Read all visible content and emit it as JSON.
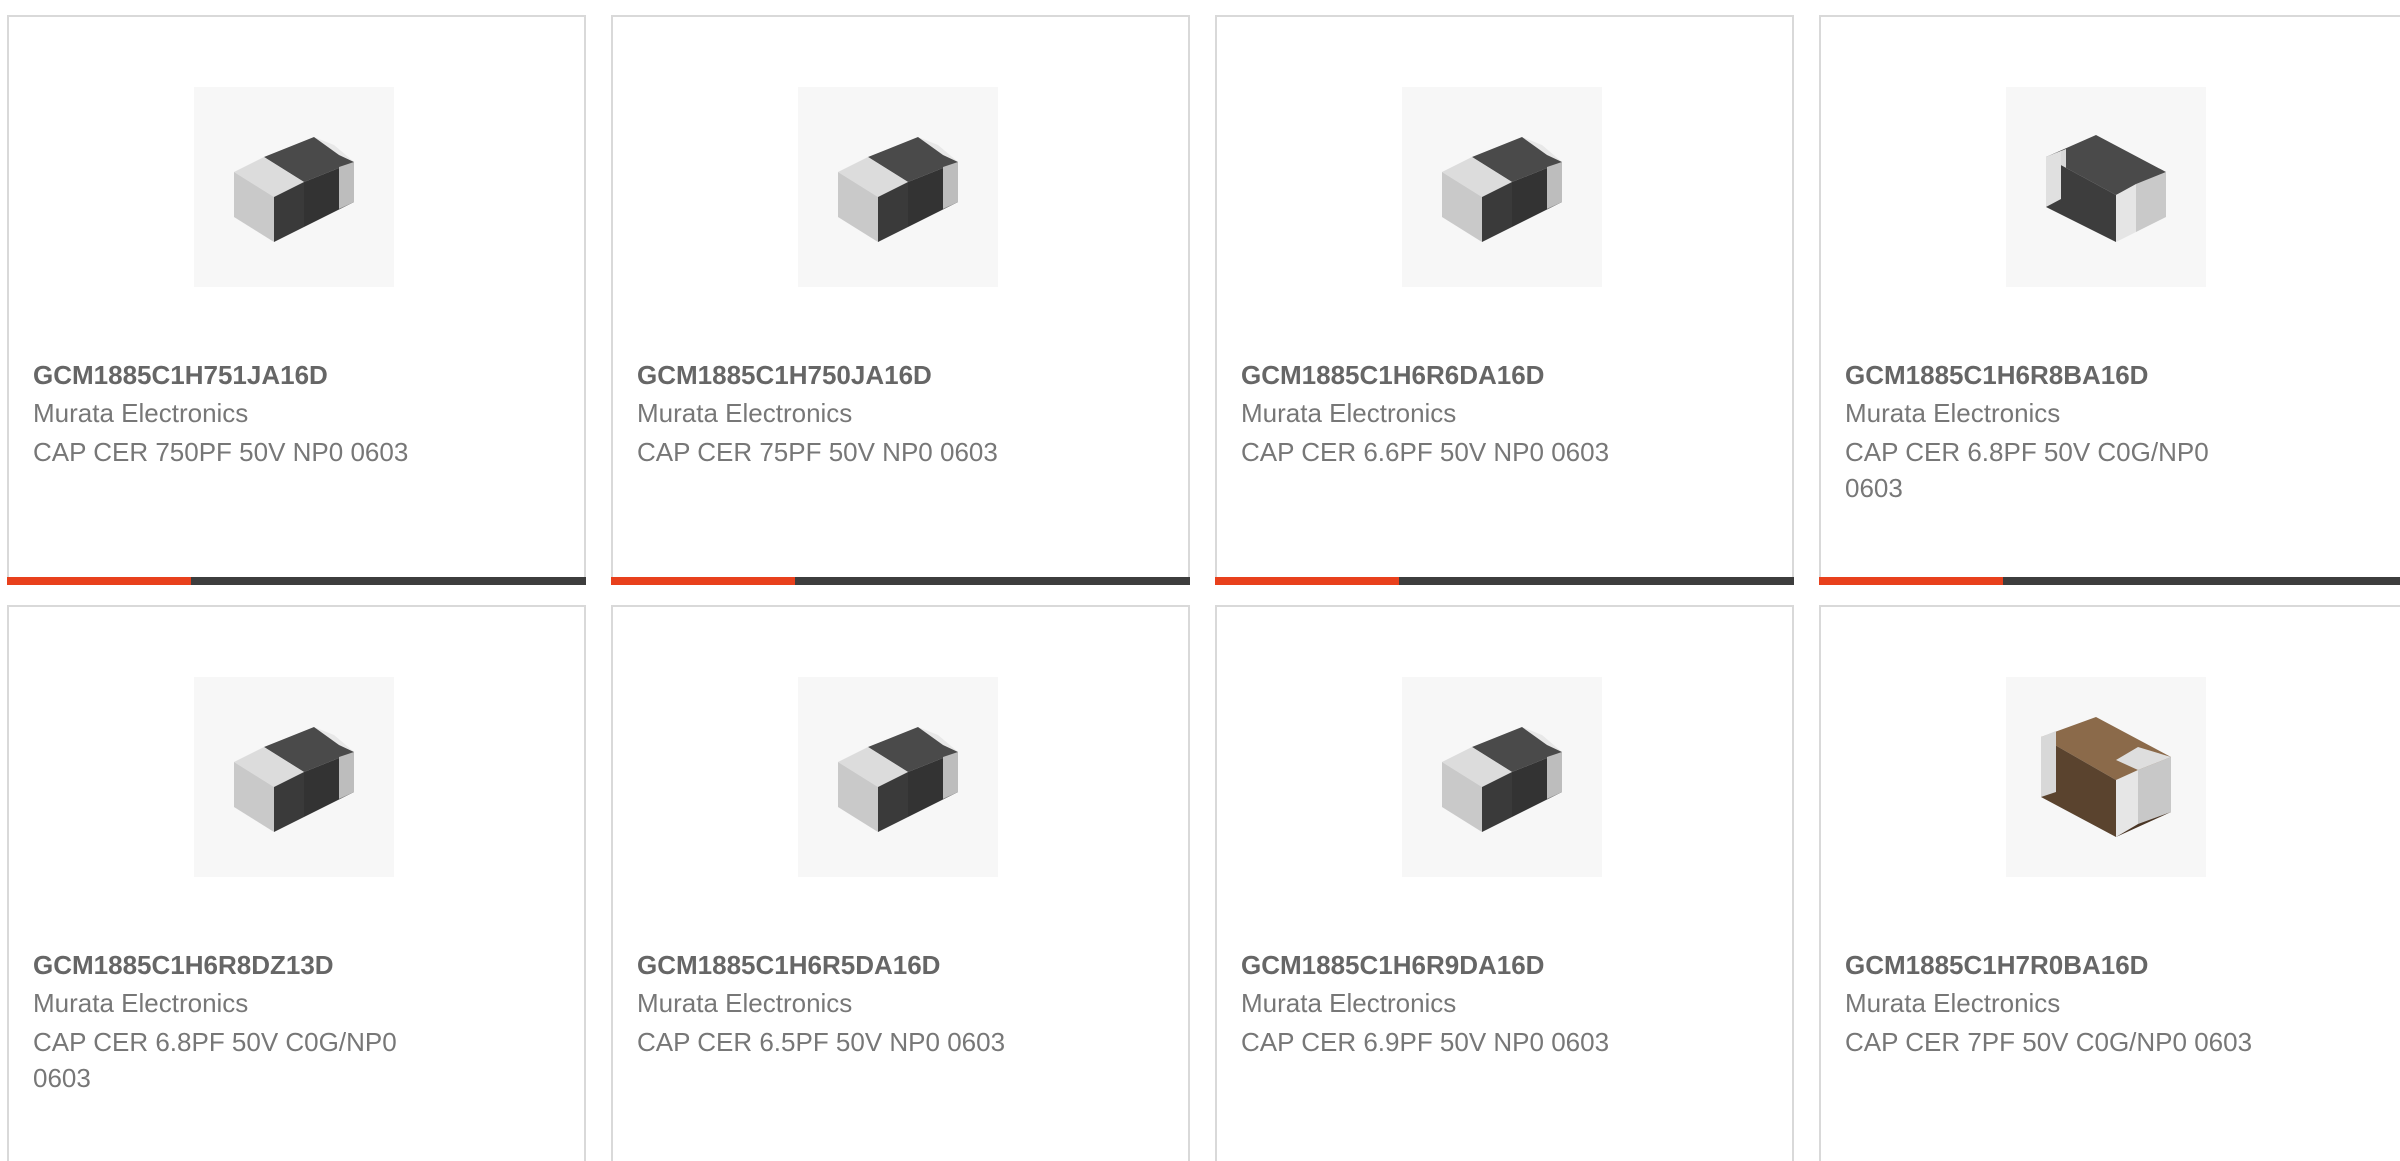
{
  "colors": {
    "accent": "#e8401c",
    "bar": "#3d3d3d",
    "border": "#d9d9d9",
    "part_number": "#666666",
    "text": "#777777"
  },
  "products": [
    {
      "part_number": "GCM1885C1H751JA16D",
      "manufacturer": "Murata Electronics",
      "description": "CAP CER 750PF 50V NP0 0603",
      "image_icon": "capacitor-chip-grey"
    },
    {
      "part_number": "GCM1885C1H750JA16D",
      "manufacturer": "Murata Electronics",
      "description": "CAP CER 75PF 50V NP0 0603",
      "image_icon": "capacitor-chip-grey"
    },
    {
      "part_number": "GCM1885C1H6R6DA16D",
      "manufacturer": "Murata Electronics",
      "description": "CAP CER 6.6PF 50V NP0 0603",
      "image_icon": "capacitor-chip-grey"
    },
    {
      "part_number": "GCM1885C1H6R8BA16D",
      "manufacturer": "Murata Electronics",
      "description": "CAP CER 6.8PF 50V C0G/NP0 0603",
      "image_icon": "capacitor-chip-grey"
    },
    {
      "part_number": "GCM1885C1H6R8DZ13D",
      "manufacturer": "Murata Electronics",
      "description": "CAP CER 6.8PF 50V C0G/NP0 0603",
      "image_icon": "capacitor-chip-grey"
    },
    {
      "part_number": "GCM1885C1H6R5DA16D",
      "manufacturer": "Murata Electronics",
      "description": "CAP CER 6.5PF 50V NP0 0603",
      "image_icon": "capacitor-chip-grey"
    },
    {
      "part_number": "GCM1885C1H6R9DA16D",
      "manufacturer": "Murata Electronics",
      "description": "CAP CER 6.9PF 50V NP0 0603",
      "image_icon": "capacitor-chip-grey"
    },
    {
      "part_number": "GCM1885C1H7R0BA16D",
      "manufacturer": "Murata Electronics",
      "description": "CAP CER 7PF 50V C0G/NP0 0603",
      "image_icon": "capacitor-chip-brown"
    }
  ]
}
